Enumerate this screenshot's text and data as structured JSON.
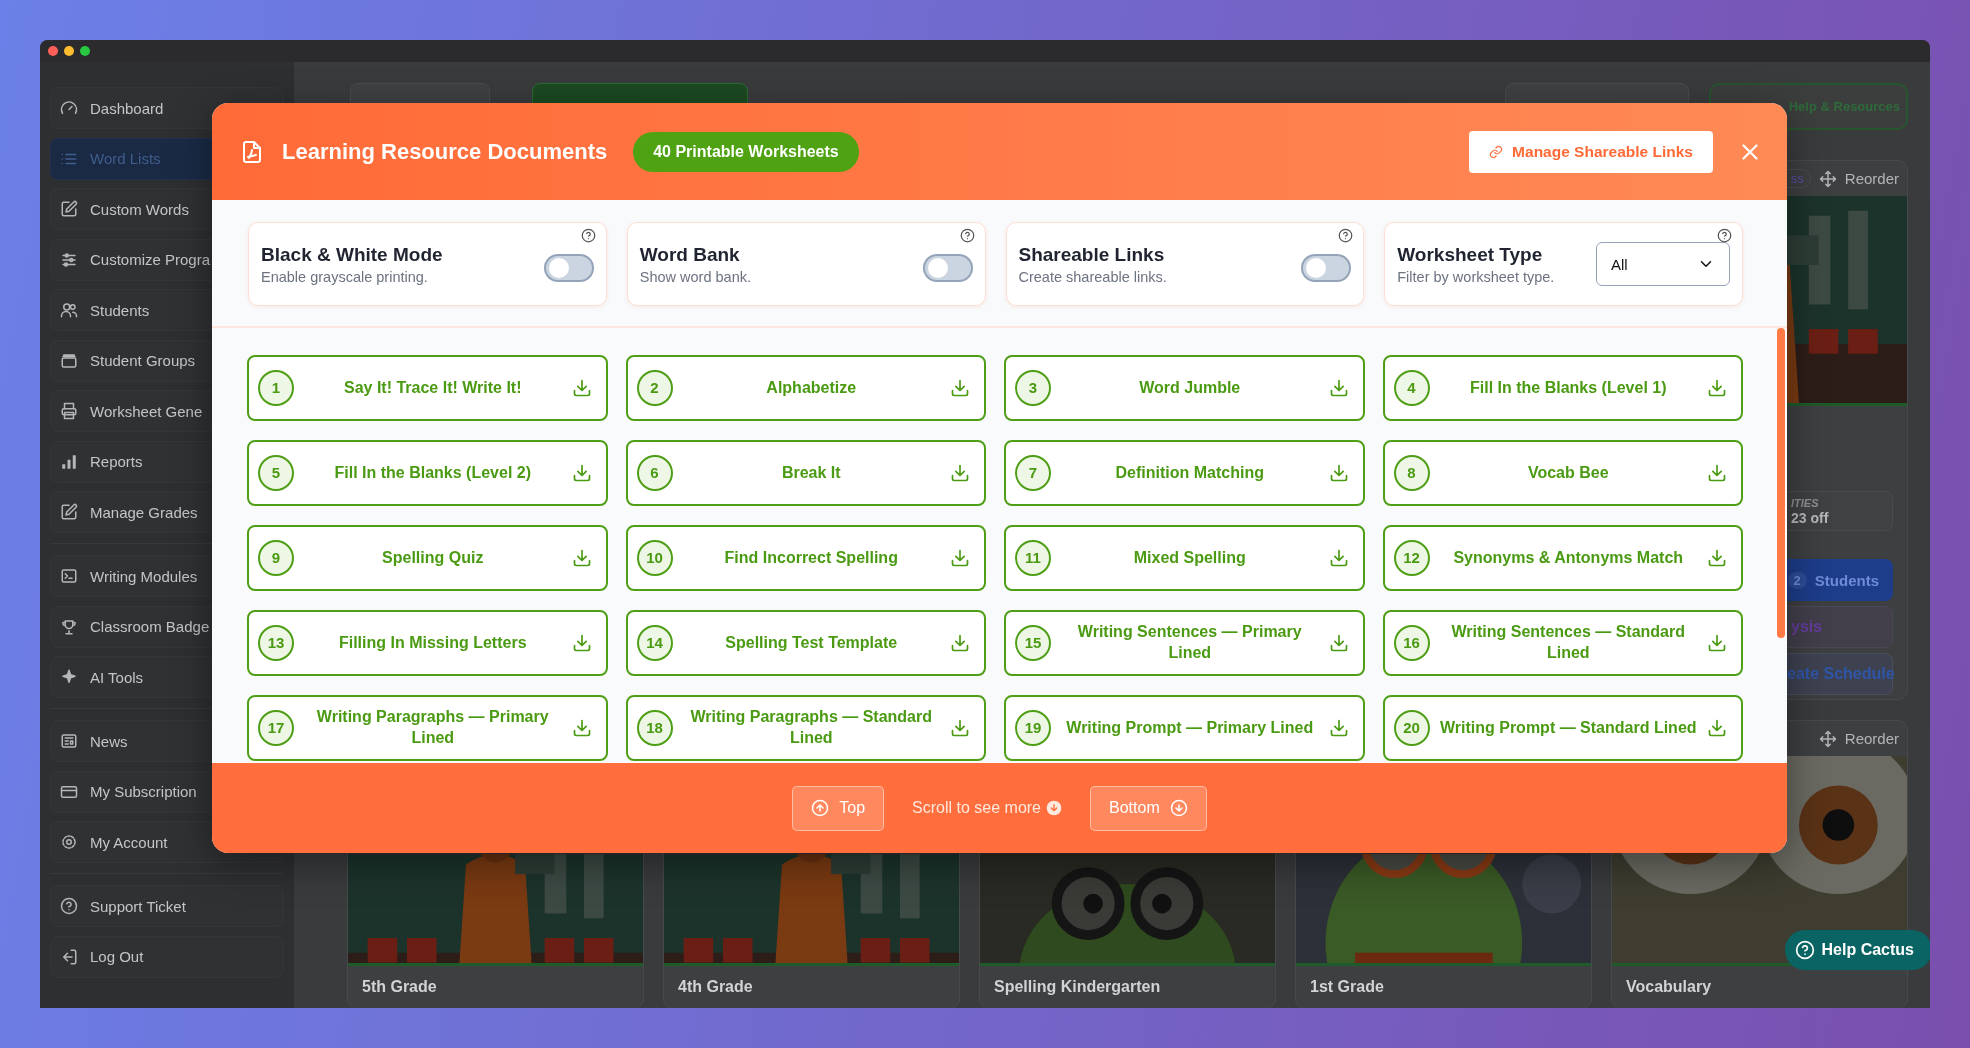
{
  "sidebar": {
    "groups": [
      {
        "items": [
          {
            "label": "Dashboard",
            "selected": false
          },
          {
            "label": "Word Lists",
            "selected": true
          },
          {
            "label": "Custom Words",
            "selected": false
          },
          {
            "label": "Customize Progra",
            "selected": false
          },
          {
            "label": "Students",
            "selected": false
          },
          {
            "label": "Student Groups",
            "selected": false
          },
          {
            "label": "Worksheet Gene",
            "selected": false
          },
          {
            "label": "Reports",
            "selected": false
          },
          {
            "label": "Manage Grades",
            "selected": false
          }
        ]
      },
      {
        "items": [
          {
            "label": "Writing Modules",
            "selected": false
          },
          {
            "label": "Classroom Badge",
            "selected": false
          },
          {
            "label": "AI Tools",
            "selected": false
          }
        ]
      },
      {
        "items": [
          {
            "label": "News",
            "selected": false
          },
          {
            "label": "My Subscription",
            "selected": false
          },
          {
            "label": "My Account",
            "selected": false
          }
        ]
      },
      {
        "items": [
          {
            "label": "Support Ticket",
            "selected": false
          },
          {
            "label": "Log Out",
            "selected": false
          }
        ]
      }
    ]
  },
  "toolbar": {
    "help_button": "Help & Resources"
  },
  "side_card": {
    "badge": "ss",
    "reorder": "Reorder",
    "stat_label": "ITIES",
    "stat_value": "23 off",
    "students_count": "2",
    "students_button": "Students",
    "analysis_button": "ysis",
    "schedule_button": "eate Schedule"
  },
  "cards": [
    {
      "title": "5th Grade"
    },
    {
      "title": "4th Grade"
    },
    {
      "title": "Spelling Kindergarten"
    },
    {
      "title": "1st Grade"
    },
    {
      "title": "Vocabulary",
      "reorder": "Reorder"
    }
  ],
  "modal": {
    "title": "Learning Resource Documents",
    "count_badge": "40 Printable Worksheets",
    "manage_button": "Manage Shareable Links",
    "settings": [
      {
        "kind": "toggle",
        "title": "Black & White Mode",
        "description": "Enable grayscale printing.",
        "on": false
      },
      {
        "kind": "toggle",
        "title": "Word Bank",
        "description": "Show word bank.",
        "on": false
      },
      {
        "kind": "toggle",
        "title": "Shareable Links",
        "description": "Create shareable links.",
        "on": false
      },
      {
        "kind": "select",
        "title": "Worksheet Type",
        "description": "Filter by worksheet type.",
        "value": "All"
      }
    ],
    "worksheets": [
      {
        "number": "1",
        "title": "Say It! Trace It! Write It!"
      },
      {
        "number": "2",
        "title": "Alphabetize"
      },
      {
        "number": "3",
        "title": "Word Jumble"
      },
      {
        "number": "4",
        "title": "Fill In the Blanks (Level 1)"
      },
      {
        "number": "5",
        "title": "Fill In the Blanks (Level 2)"
      },
      {
        "number": "6",
        "title": "Break It"
      },
      {
        "number": "7",
        "title": "Definition Matching"
      },
      {
        "number": "8",
        "title": "Vocab Bee"
      },
      {
        "number": "9",
        "title": "Spelling Quiz"
      },
      {
        "number": "10",
        "title": "Find Incorrect Spelling"
      },
      {
        "number": "11",
        "title": "Mixed Spelling"
      },
      {
        "number": "12",
        "title": "Synonyms & Antonyms Match"
      },
      {
        "number": "13",
        "title": "Filling In Missing Letters"
      },
      {
        "number": "14",
        "title": "Spelling Test Template"
      },
      {
        "number": "15",
        "title": "Writing Sentences — Primary Lined"
      },
      {
        "number": "16",
        "title": "Writing Sentences — Standard Lined"
      },
      {
        "number": "17",
        "title": "Writing Paragraphs — Primary Lined"
      },
      {
        "number": "18",
        "title": "Writing Paragraphs — Standard Lined"
      },
      {
        "number": "19",
        "title": "Writing Prompt — Primary Lined"
      },
      {
        "number": "20",
        "title": "Writing Prompt — Standard Lined"
      }
    ],
    "footer": {
      "top_button": "Top",
      "hint": "Scroll to see more",
      "bottom_button": "Bottom"
    }
  },
  "help_button": "Help Cactus"
}
